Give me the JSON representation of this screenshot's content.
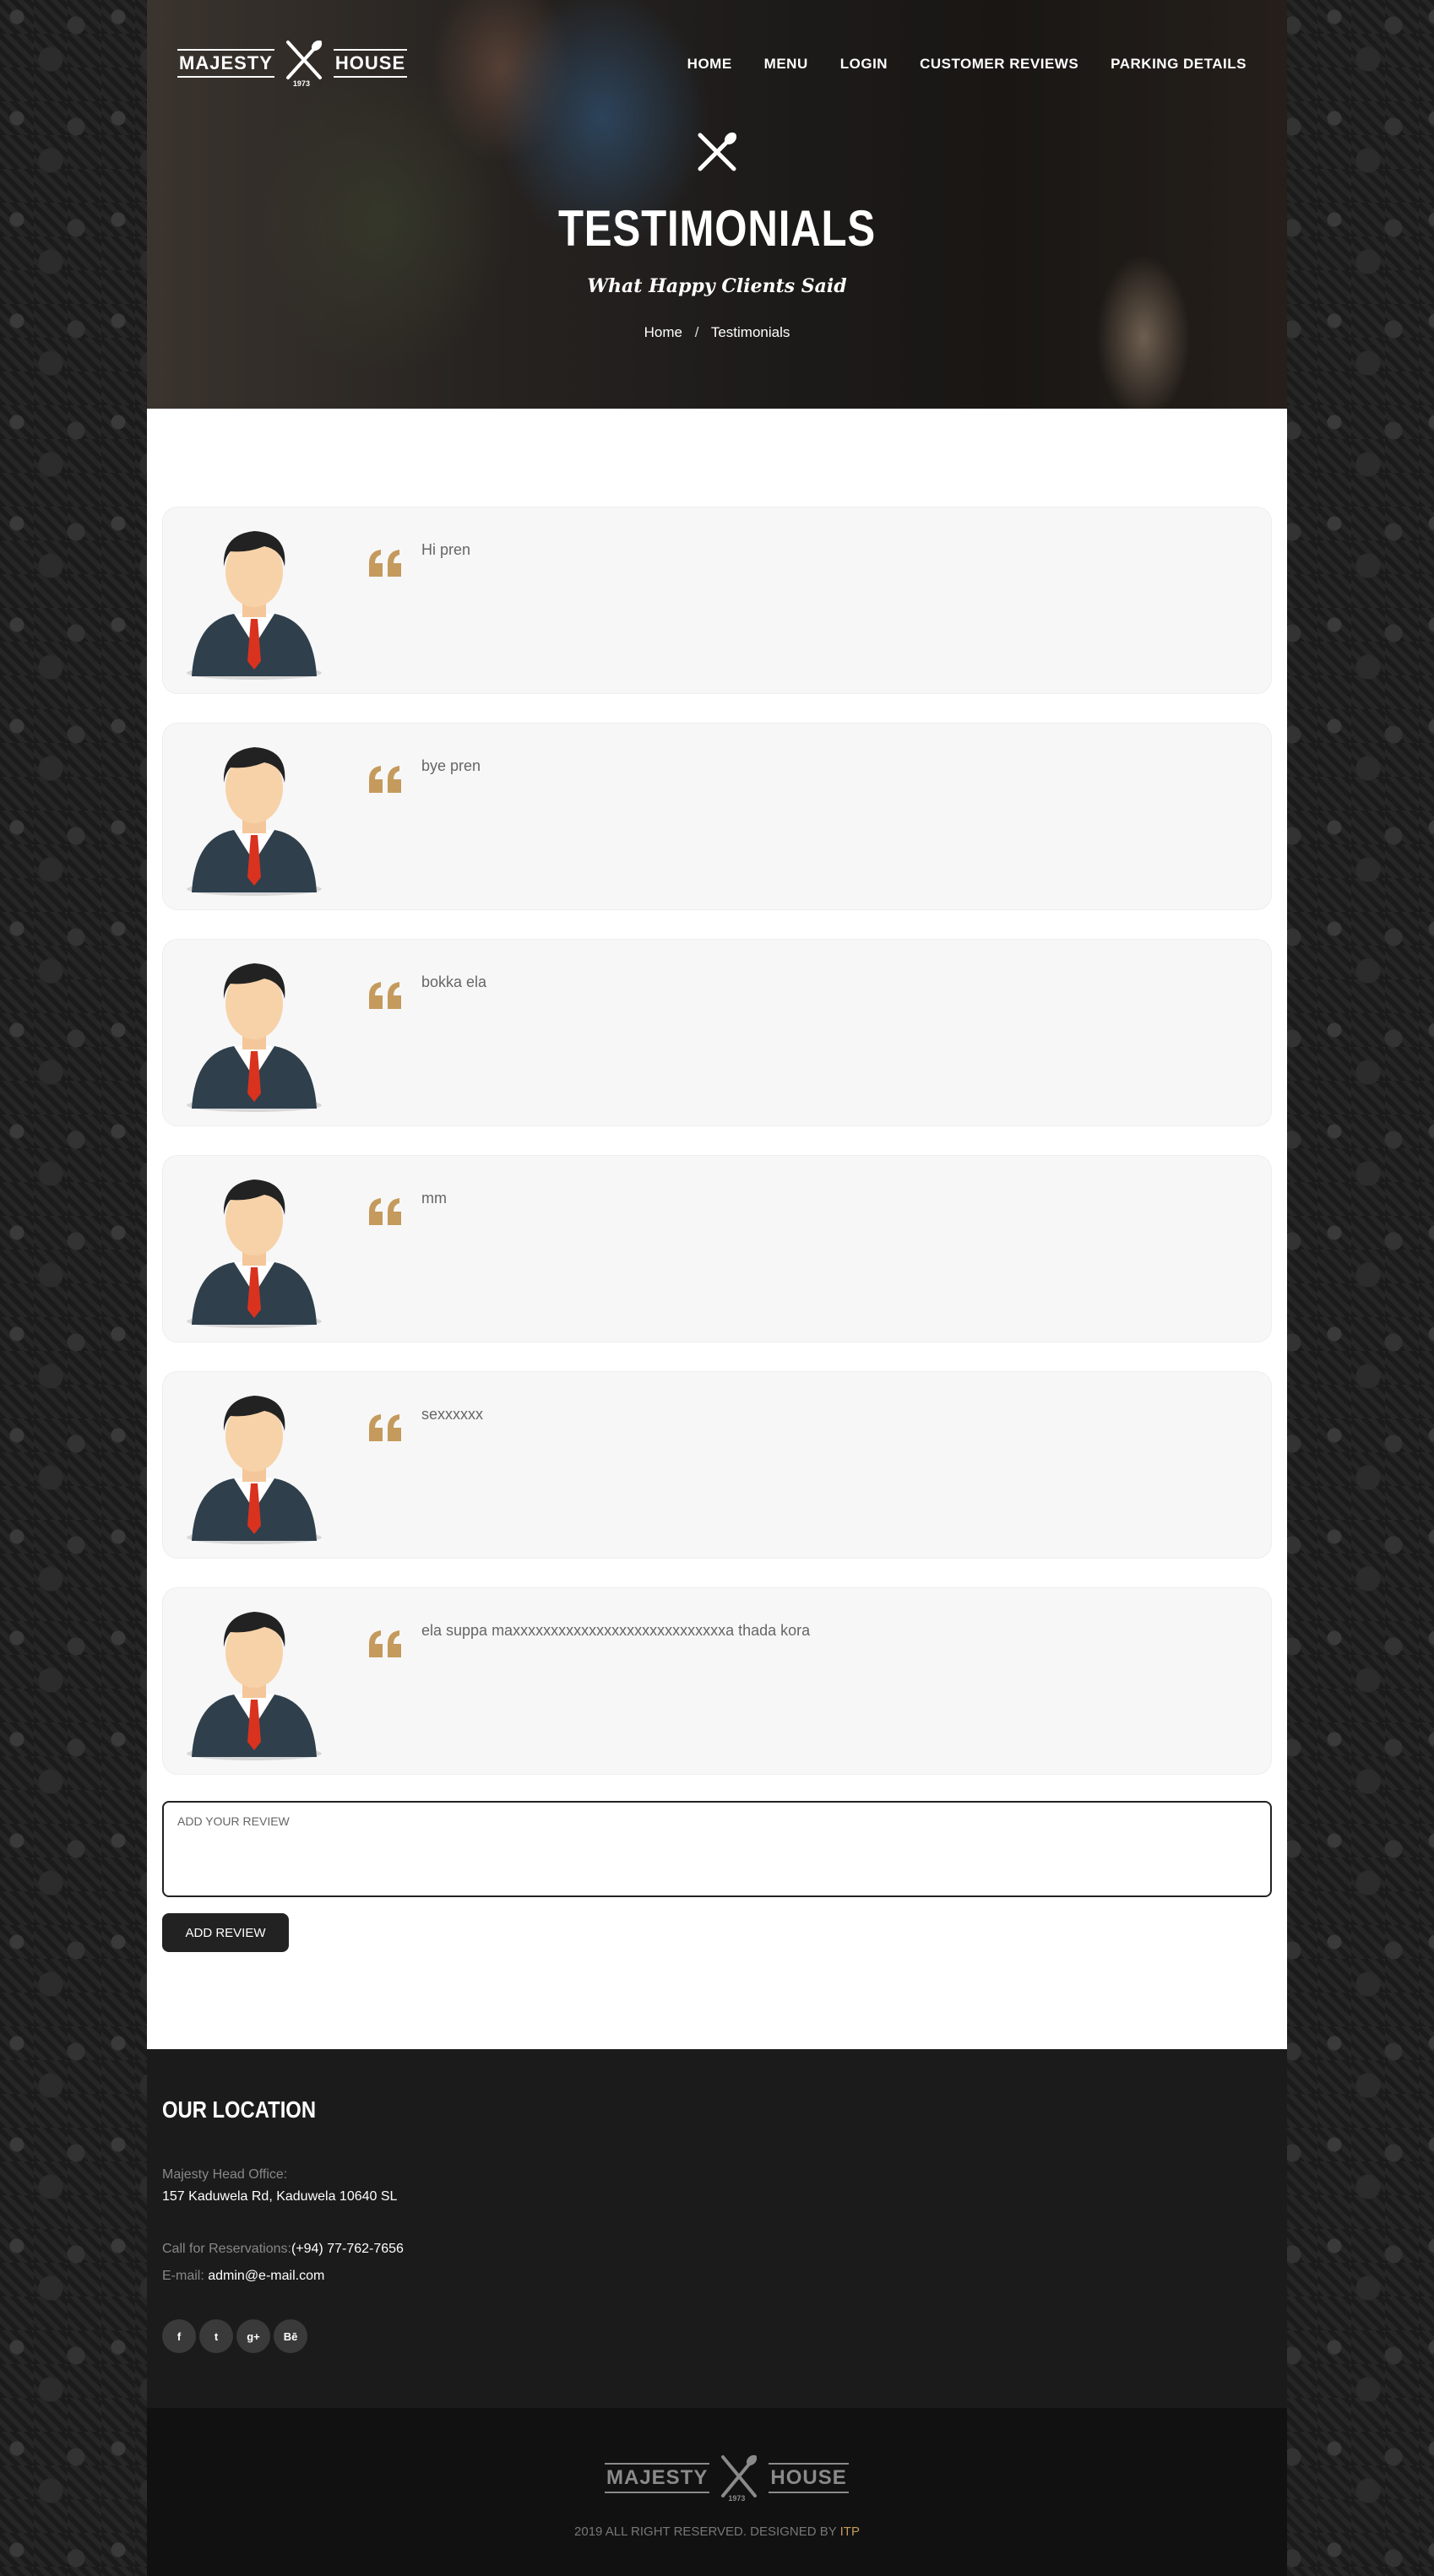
{
  "brand": {
    "left_word": "MAJESTY",
    "right_word": "HOUSE",
    "year": "1973"
  },
  "nav": [
    "HOME",
    "MENU",
    "LOGIN",
    "CUSTOMER REVIEWS",
    "PARKING DETAILS"
  ],
  "hero": {
    "title": "TESTIMONIALS",
    "subtitle": "What Happy Clients Said",
    "breadcrumb": {
      "home": "Home",
      "separator": "/",
      "current": "Testimonials"
    }
  },
  "reviews": [
    {
      "text": "Hi pren"
    },
    {
      "text": "bye pren"
    },
    {
      "text": "bokka ela"
    },
    {
      "text": "mm"
    },
    {
      "text": "sexxxxxx"
    },
    {
      "text": "ela suppa maxxxxxxxxxxxxxxxxxxxxxxxxxxxxa thada kora"
    }
  ],
  "form": {
    "placeholder": "ADD YOUR REVIEW",
    "button": "ADD REVIEW"
  },
  "footer": {
    "title": "OUR LOCATION",
    "office_label": "Majesty Head Office:",
    "address": "157 Kaduwela Rd, Kaduwela 10640 SL",
    "reservation_label": "Call for Reservations:",
    "phone": "(+94) 77-762-7656",
    "email_label": "E-mail:",
    "email": "admin@e-mail.com",
    "socials": [
      {
        "icon": "facebook-icon",
        "glyph": "f"
      },
      {
        "icon": "twitter-icon",
        "glyph": "t"
      },
      {
        "icon": "google-plus-icon",
        "glyph": "g+"
      },
      {
        "icon": "behance-icon",
        "glyph": "Bē"
      }
    ],
    "copyright": "2019 ALL RIGHT RESERVED. DESIGNED BY",
    "designer": "ITP"
  },
  "colors": {
    "accent": "#c59a5d",
    "card_bg": "#f7f7f7",
    "footer_bg": "#1b1b1b"
  }
}
